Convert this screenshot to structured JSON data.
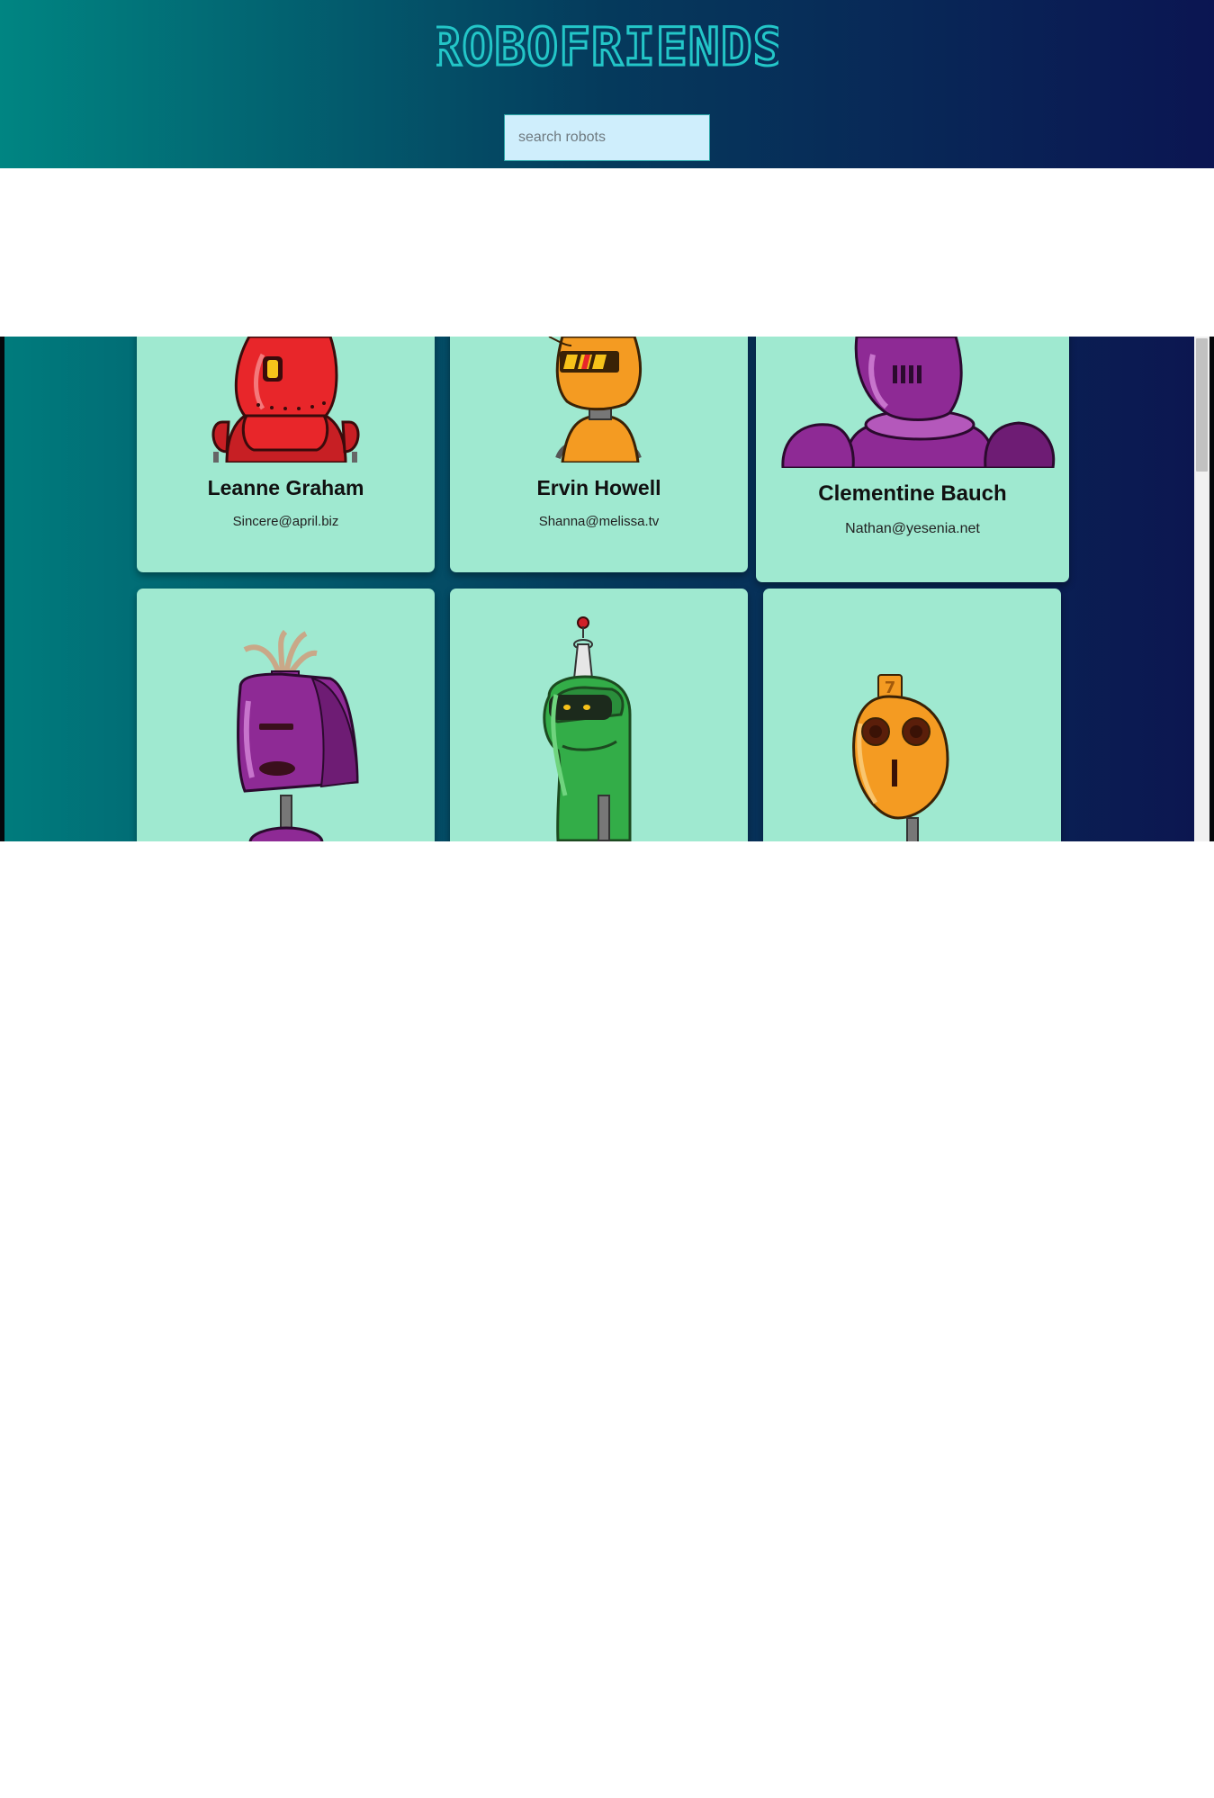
{
  "app": {
    "title": "ROBOFRIENDS",
    "title_color": "#23c6c8",
    "header_gradient": [
      "#008582",
      "#053a5c",
      "#0b1552"
    ]
  },
  "search": {
    "placeholder": "search robots",
    "value": ""
  },
  "cards": [
    {
      "name": "Leanne Graham",
      "email": "Sincere@april.biz",
      "robot_color": "#e8262a",
      "robot_icon": "red-robot-icon"
    },
    {
      "name": "Ervin Howell",
      "email": "Shanna@melissa.tv",
      "robot_color": "#f49b22",
      "robot_icon": "orange-robot-icon"
    },
    {
      "name": "Clementine Bauch",
      "email": "Nathan@yesenia.net",
      "robot_color": "#8e2a95",
      "robot_icon": "purple-robot-icon"
    },
    {
      "name": "",
      "email": "",
      "robot_color": "#8e2a95",
      "robot_icon": "purple-antenna-robot-icon"
    },
    {
      "name": "",
      "email": "",
      "robot_color": "#33ad48",
      "robot_icon": "green-robot-icon"
    },
    {
      "name": "",
      "email": "",
      "robot_color": "#f49b22",
      "robot_icon": "orange-oval-robot-icon"
    }
  ],
  "card_color": "#9fe9d0"
}
